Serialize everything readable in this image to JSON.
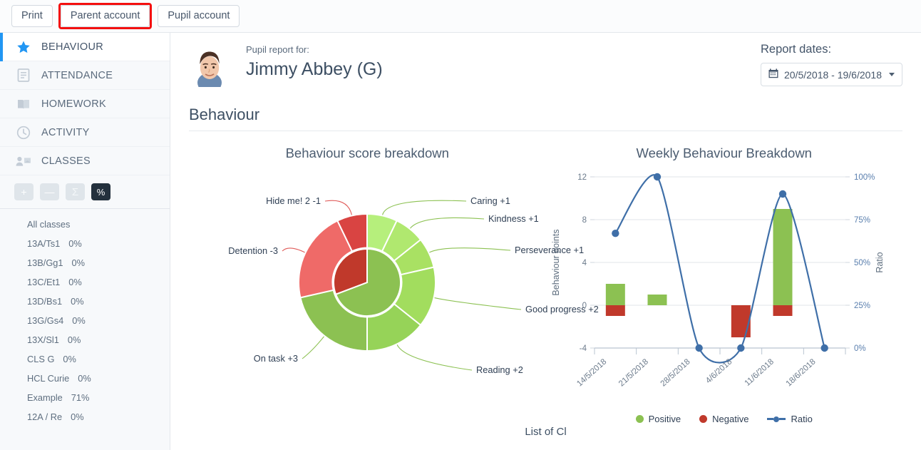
{
  "topbar": {
    "buttons": [
      {
        "label": "Print",
        "name": "print-button",
        "highlighted": false
      },
      {
        "label": "Parent account",
        "name": "parent-account-button",
        "highlighted": true
      },
      {
        "label": "Pupil account",
        "name": "pupil-account-button",
        "highlighted": false
      }
    ],
    "highlight_color": "#f40f0f"
  },
  "sidebar": {
    "nav": [
      {
        "label": "BEHAVIOUR",
        "icon": "star-icon",
        "active": true
      },
      {
        "label": "ATTENDANCE",
        "icon": "document-icon",
        "active": false
      },
      {
        "label": "HOMEWORK",
        "icon": "book-icon",
        "active": false
      },
      {
        "label": "ACTIVITY",
        "icon": "clock-icon",
        "active": false
      },
      {
        "label": "CLASSES",
        "icon": "classes-icon",
        "active": false
      }
    ],
    "active_accent": "#2196f3",
    "tools": [
      {
        "label": "+",
        "name": "plus-button",
        "active": false
      },
      {
        "label": "—",
        "name": "minus-button",
        "active": false
      },
      {
        "label": "Σ",
        "name": "sum-button",
        "active": false
      },
      {
        "label": "%",
        "name": "percent-button",
        "active": true
      }
    ],
    "classes_header": "All classes",
    "classes": [
      {
        "name": "13A/Ts1",
        "percent": "0%"
      },
      {
        "name": "13B/Gg1",
        "percent": "0%"
      },
      {
        "name": "13C/Et1",
        "percent": "0%"
      },
      {
        "name": "13D/Bs1",
        "percent": "0%"
      },
      {
        "name": "13G/Gs4",
        "percent": "0%"
      },
      {
        "name": "13X/Sl1",
        "percent": "0%"
      },
      {
        "name": "CLS G",
        "percent": "0%"
      },
      {
        "name": "HCL Curie",
        "percent": "0%"
      },
      {
        "name": "Example",
        "percent": "71%"
      },
      {
        "name": "12A / Re",
        "percent": "0%"
      }
    ]
  },
  "header": {
    "pupil_report_label": "Pupil report for:",
    "pupil_name": "Jimmy Abbey (G)",
    "report_dates_label": "Report dates:",
    "date_range": "20/5/2018 - 19/6/2018"
  },
  "main": {
    "section_title": "Behaviour",
    "bottom_partial_text": "List of Cl"
  },
  "chart_data": [
    {
      "type": "pie",
      "title": "Behaviour score breakdown",
      "inner_ring": [
        {
          "name": "Positive",
          "value": 9,
          "color": "#8cc152"
        },
        {
          "name": "Negative",
          "value": 4,
          "color": "#c0392b"
        }
      ],
      "outer_ring": [
        {
          "label": "Caring +1",
          "value": 1,
          "color": "#b6ef7c"
        },
        {
          "label": "Kindness +1",
          "value": 1,
          "color": "#b0e86f"
        },
        {
          "label": "Perseverance +1",
          "value": 1,
          "color": "#a9e163"
        },
        {
          "label": "Good progress +2",
          "value": 2,
          "color": "#a2dd5e"
        },
        {
          "label": "Reading +2",
          "value": 2,
          "color": "#96d358"
        },
        {
          "label": "On task +3",
          "value": 3,
          "color": "#8cc152"
        },
        {
          "label": "Detention -3",
          "value": 3,
          "color": "#ef6a68"
        },
        {
          "label": "Hide me! 2 -1",
          "value": 1,
          "color": "#d94442"
        }
      ],
      "legend": "labelled-slices"
    },
    {
      "type": "bar",
      "title": "Weekly Behaviour Breakdown",
      "categories": [
        "14/5/2018",
        "21/5/2018",
        "28/5/2018",
        "4/6/2018",
        "11/6/2018",
        "18/6/2018"
      ],
      "xlabel": "",
      "ylabel": "Behaviour points",
      "ylabel_right": "Ratio",
      "ylim": [
        -4,
        12
      ],
      "yticks": [
        "-4",
        "0",
        "4",
        "8",
        "12"
      ],
      "ylim_right": [
        0,
        100
      ],
      "yticks_right": [
        "0%",
        "25%",
        "50%",
        "75%",
        "100%"
      ],
      "grid": true,
      "series": [
        {
          "name": "Positive",
          "type": "bar",
          "color": "#8cc152",
          "values": [
            2,
            1,
            0,
            0,
            9,
            0
          ]
        },
        {
          "name": "Negative",
          "type": "bar",
          "color": "#c0392b",
          "values": [
            -1,
            0,
            0,
            -3,
            -1,
            0
          ]
        },
        {
          "name": "Ratio",
          "type": "line",
          "color": "#3f6fa8",
          "axis": "right",
          "values": [
            67,
            100,
            0,
            0,
            90,
            0
          ]
        }
      ],
      "legend": [
        "Positive",
        "Negative",
        "Ratio"
      ],
      "legend_position": "bottom"
    }
  ]
}
